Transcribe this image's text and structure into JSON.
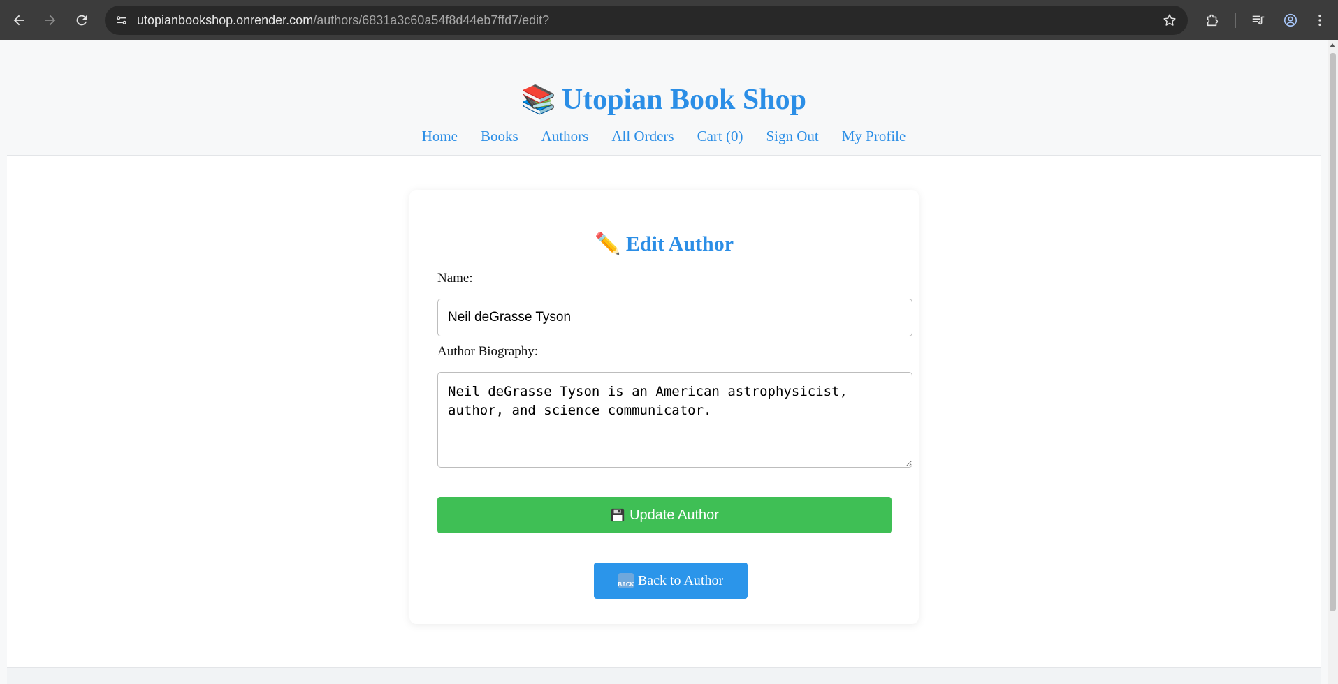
{
  "browser": {
    "url_host": "utopianbookshop.onrender.com",
    "url_path": "/authors/6831a3c60a54f8d44eb7ffd7/edit?"
  },
  "site": {
    "title": "Utopian Book Shop",
    "title_emoji": "📚",
    "nav": [
      "Home",
      "Books",
      "Authors",
      "All Orders",
      "Cart (0)",
      "Sign Out",
      "My Profile"
    ]
  },
  "form": {
    "heading_emoji": "✏️",
    "heading": "Edit Author",
    "name_label": "Name:",
    "name_value": "Neil deGrasse Tyson",
    "bio_label": "Author Biography:",
    "bio_value": "Neil deGrasse Tyson is an American astrophysicist, author, and science communicator.",
    "update_label": "Update Author",
    "back_label": "Back to Author",
    "back_icon_text": "BACK"
  },
  "colors": {
    "accent": "#2b8ee6",
    "update_button": "#3fbf55",
    "back_button": "#2b95ea"
  }
}
